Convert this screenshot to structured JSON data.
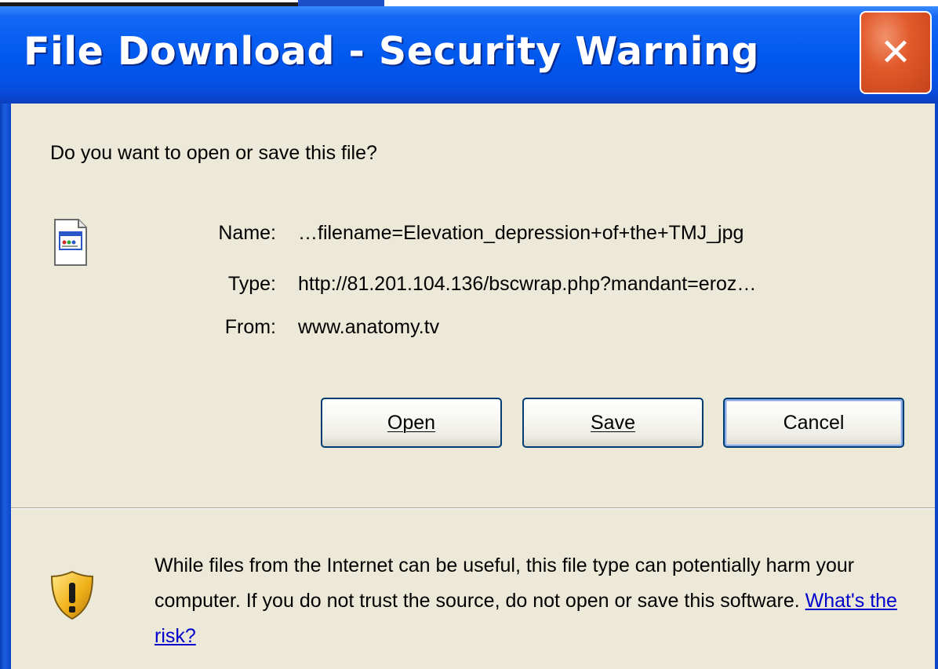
{
  "window": {
    "title": "File Download - Security Warning",
    "close_label": "✕"
  },
  "dialog": {
    "question": "Do you want to open or save this file?",
    "file": {
      "name_label": "Name:",
      "name_value": "…filename=Elevation_depression+of+the+TMJ_jpg",
      "type_label": "Type:",
      "type_value": "http://81.201.104.136/bscwrap.php?mandant=eroz…",
      "from_label": "From:",
      "from_value": "www.anatomy.tv"
    },
    "buttons": {
      "open": "Open",
      "save": "Save",
      "cancel": "Cancel"
    },
    "warning": {
      "text": "While files from the Internet can be useful, this file type can potentially harm your computer. If you do not trust the source, do not open or save this software.",
      "link": "What's the risk?"
    }
  },
  "icons": {
    "file": "file-document-icon",
    "shield": "security-shield-warning-icon"
  },
  "colors": {
    "titlebar": "#0058ee",
    "dialog_bg": "#ece9d8",
    "close_button": "#e15a2b",
    "link": "#0000cc"
  }
}
